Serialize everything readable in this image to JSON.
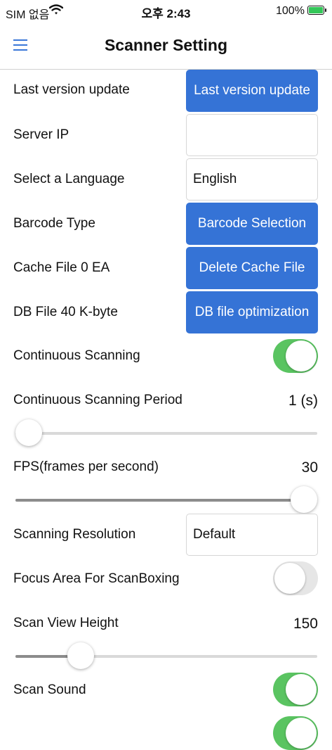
{
  "status": {
    "carrier": "SIM 없음",
    "time": "오후 2:43",
    "battery": "100%"
  },
  "nav": {
    "title": "Scanner Setting"
  },
  "rows": {
    "last_version": {
      "label": "Last version update",
      "button": "Last version update"
    },
    "server_ip": {
      "label": "Server IP",
      "value": ""
    },
    "language": {
      "label": "Select a Language",
      "value": "English"
    },
    "barcode": {
      "label": "Barcode Type",
      "button": "Barcode Selection"
    },
    "cache": {
      "label": "Cache File  0 EA",
      "button": "Delete Cache File"
    },
    "db": {
      "label": "DB File  40 K-byte",
      "button": "DB file optimization"
    },
    "continuous": {
      "label": "Continuous Scanning",
      "on": true
    },
    "period": {
      "label": "Continuous Scanning Period",
      "value": "1 (s)",
      "level": 0.0
    },
    "fps": {
      "label": "FPS(frames per second)",
      "value": "30",
      "level": 1.0
    },
    "resolution": {
      "label": "Scanning Resolution",
      "value": "Default"
    },
    "focus": {
      "label": "Focus Area For ScanBoxing",
      "on": false
    },
    "view_height": {
      "label": "Scan View Height",
      "value": "150",
      "level": 0.19
    },
    "sound": {
      "label": "Scan Sound",
      "on": true
    }
  },
  "colors": {
    "accent": "#3573d6",
    "toggle_on": "#5ac461"
  }
}
